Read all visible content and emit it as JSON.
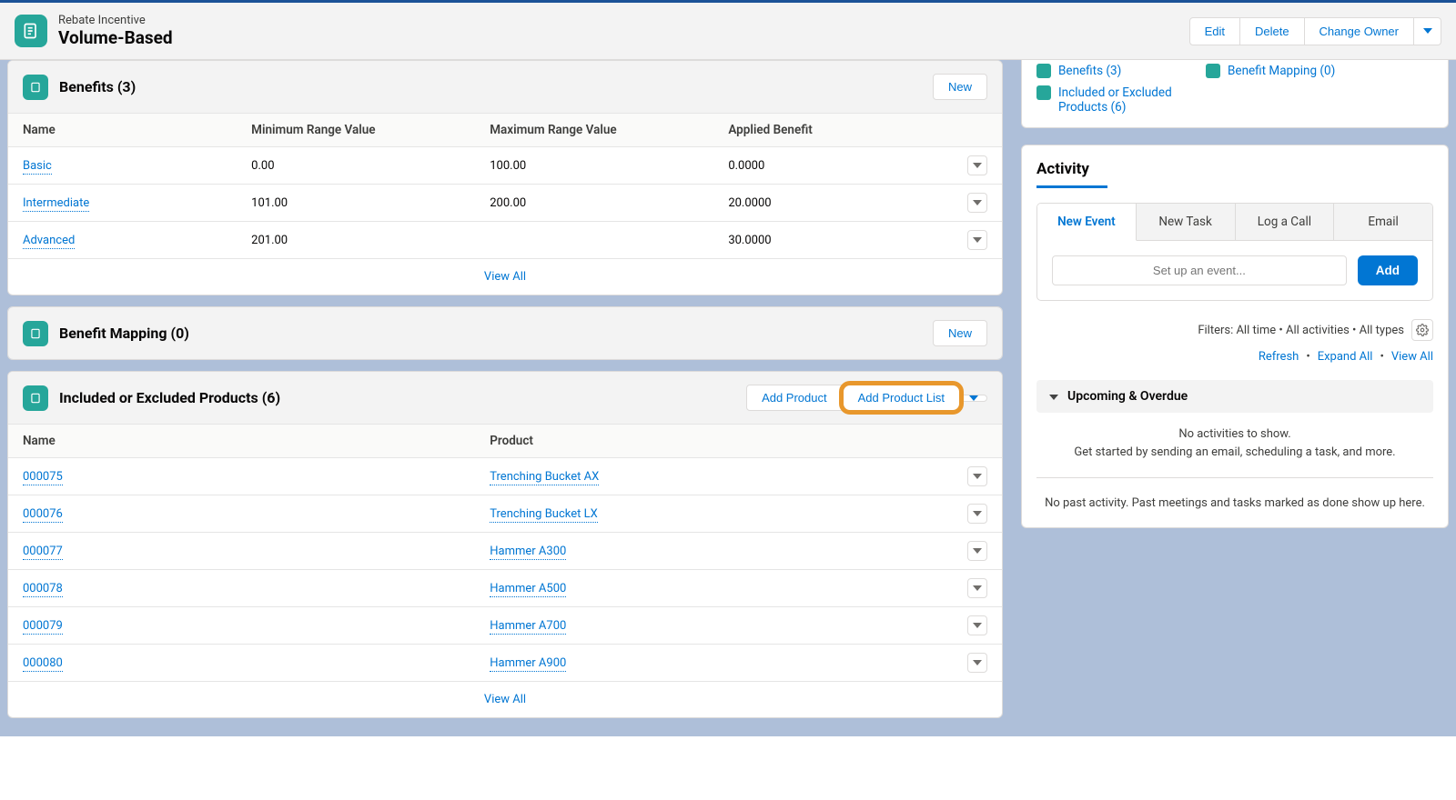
{
  "header": {
    "rec_type": "Rebate Incentive",
    "rec_name": "Volume-Based",
    "actions": {
      "edit": "Edit",
      "delete": "Delete",
      "change_owner": "Change Owner"
    }
  },
  "benefits": {
    "title": "Benefits (3)",
    "new": "New",
    "columns": {
      "name": "Name",
      "min": "Minimum Range Value",
      "max": "Maximum Range Value",
      "applied": "Applied Benefit"
    },
    "rows": [
      {
        "name": "Basic",
        "min": "0.00",
        "max": "100.00",
        "applied": "0.0000"
      },
      {
        "name": "Intermediate",
        "min": "101.00",
        "max": "200.00",
        "applied": "20.0000"
      },
      {
        "name": "Advanced",
        "min": "201.00",
        "max": "",
        "applied": "30.0000"
      }
    ],
    "view_all": "View All"
  },
  "mapping": {
    "title": "Benefit Mapping (0)",
    "new": "New"
  },
  "products": {
    "title": "Included or Excluded Products (6)",
    "add_product": "Add Product",
    "add_product_list": "Add Product List",
    "columns": {
      "name": "Name",
      "product": "Product"
    },
    "rows": [
      {
        "name": "000075",
        "product": "Trenching Bucket AX"
      },
      {
        "name": "000076",
        "product": "Trenching Bucket LX"
      },
      {
        "name": "000077",
        "product": "Hammer A300"
      },
      {
        "name": "000078",
        "product": "Hammer A500"
      },
      {
        "name": "000079",
        "product": "Hammer A700"
      },
      {
        "name": "000080",
        "product": "Hammer A900"
      }
    ],
    "view_all": "View All"
  },
  "quick_links": {
    "benefits": "Benefits (3)",
    "included": "Included or Excluded Products (6)",
    "mapping": "Benefit Mapping (0)"
  },
  "activity": {
    "title": "Activity",
    "tabs": {
      "event": "New Event",
      "task": "New Task",
      "call": "Log a Call",
      "email": "Email"
    },
    "placeholder": "Set up an event...",
    "add": "Add",
    "filters": "Filters: All time  •  All activities  •  All types",
    "refresh": "Refresh",
    "expand": "Expand All",
    "view_all": "View All",
    "upcoming": "Upcoming & Overdue",
    "empty1": "No activities to show.",
    "empty2": "Get started by sending an email, scheduling a task, and more.",
    "past": "No past activity. Past meetings and tasks marked as done show up here."
  }
}
